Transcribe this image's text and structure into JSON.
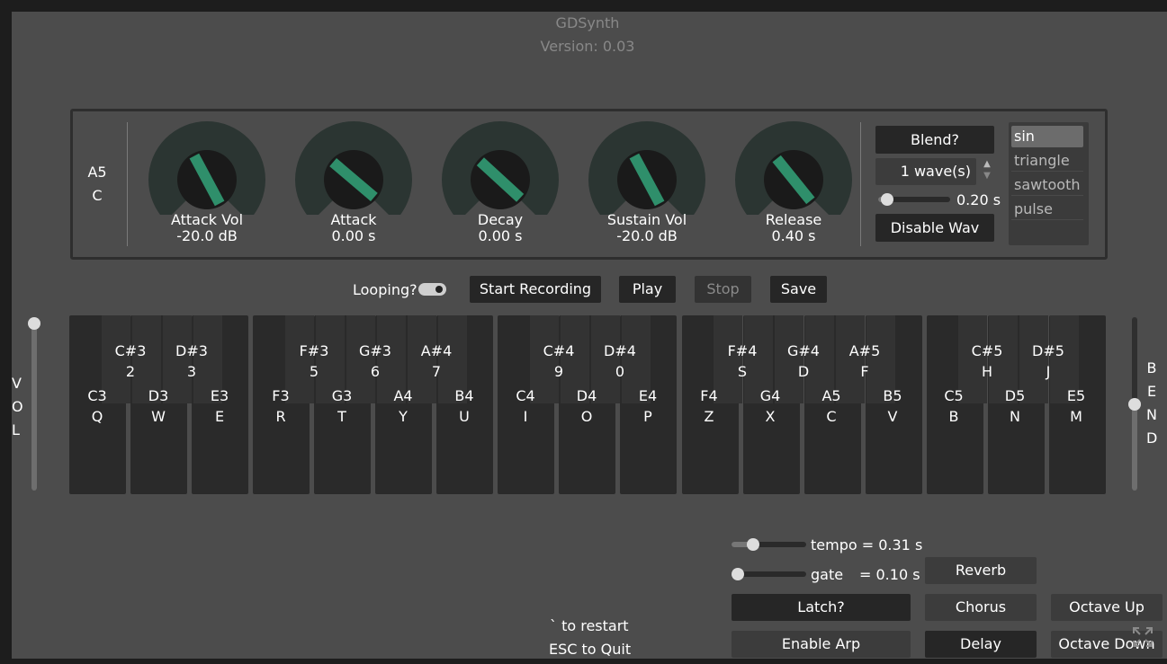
{
  "header": {
    "title": "GDSynth",
    "version": "Version: 0.03"
  },
  "note_display": {
    "note": "A5",
    "key": "C"
  },
  "knobs": [
    {
      "label": "Attack Vol",
      "value": "-20.0 dB",
      "level": 0.6
    },
    {
      "label": "Attack",
      "value": "0.00 s",
      "level": 0.4
    },
    {
      "label": "Decay",
      "value": "0.00 s",
      "level": 0.42
    },
    {
      "label": "Sustain Vol",
      "value": "-20.0 dB",
      "level": 0.6
    },
    {
      "label": "Release",
      "value": "0.40 s",
      "level": 0.5
    }
  ],
  "wave_controls": {
    "blend_label": "Blend?",
    "wave_count": "1 wave(s)",
    "blend_time": "0.20 s",
    "blend_level": 0.05,
    "disable_label": "Disable Wav"
  },
  "waveforms": {
    "options": [
      "sin",
      "triangle",
      "sawtooth",
      "pulse"
    ],
    "selected": "sin"
  },
  "transport": {
    "looping_label": "Looping?",
    "looping_on": true,
    "record_label": "Start Recording",
    "play_label": "Play",
    "stop_label": "Stop",
    "save_label": "Save"
  },
  "volume": {
    "letters": [
      "V",
      "O",
      "L"
    ],
    "level": 1.0
  },
  "bend": {
    "letters": [
      "B",
      "E",
      "N",
      "D"
    ],
    "level": 0.5
  },
  "keyboard": {
    "white_keys": [
      {
        "note": "C3",
        "key": "Q"
      },
      {
        "note": "D3",
        "key": "W"
      },
      {
        "note": "E3",
        "key": "E"
      },
      {
        "note": "F3",
        "key": "R"
      },
      {
        "note": "G3",
        "key": "T"
      },
      {
        "note": "A4",
        "key": "Y"
      },
      {
        "note": "B4",
        "key": "U"
      },
      {
        "note": "C4",
        "key": "I"
      },
      {
        "note": "D4",
        "key": "O"
      },
      {
        "note": "E4",
        "key": "P"
      },
      {
        "note": "F4",
        "key": "Z"
      },
      {
        "note": "G4",
        "key": "X"
      },
      {
        "note": "A5",
        "key": "C"
      },
      {
        "note": "B5",
        "key": "V"
      },
      {
        "note": "C5",
        "key": "B"
      },
      {
        "note": "D5",
        "key": "N"
      },
      {
        "note": "E5",
        "key": "M"
      }
    ],
    "black_keys": [
      {
        "note": "C#3",
        "key": "2"
      },
      {
        "note": "D#3",
        "key": "3"
      },
      {
        "note": "F#3",
        "key": "5"
      },
      {
        "note": "G#3",
        "key": "6"
      },
      {
        "note": "A#4",
        "key": "7"
      },
      {
        "note": "C#4",
        "key": "9"
      },
      {
        "note": "D#4",
        "key": "0"
      },
      {
        "note": "F#4",
        "key": "S"
      },
      {
        "note": "G#4",
        "key": "D"
      },
      {
        "note": "A#5",
        "key": "F"
      },
      {
        "note": "C#5",
        "key": "H"
      },
      {
        "note": "D#5",
        "key": "J"
      }
    ]
  },
  "arp": {
    "tempo_label": "tempo = 0.31 s",
    "tempo_level": 0.25,
    "gate_label": "gate",
    "gate_value": "= 0.10 s",
    "gate_level": 0.0,
    "latch_label": "Latch?",
    "enable_arp_label": "Enable Arp"
  },
  "effects": {
    "reverb": "Reverb",
    "chorus": "Chorus",
    "delay": "Delay"
  },
  "octave": {
    "up": "Octave Up",
    "down": "Octave Down"
  },
  "hints": {
    "restart": "` to restart",
    "quit": "ESC to Quit"
  },
  "colors": {
    "accent": "#2f8f6b",
    "knob_ring": "#2b3532",
    "knob_center": "#1a1a1a"
  }
}
